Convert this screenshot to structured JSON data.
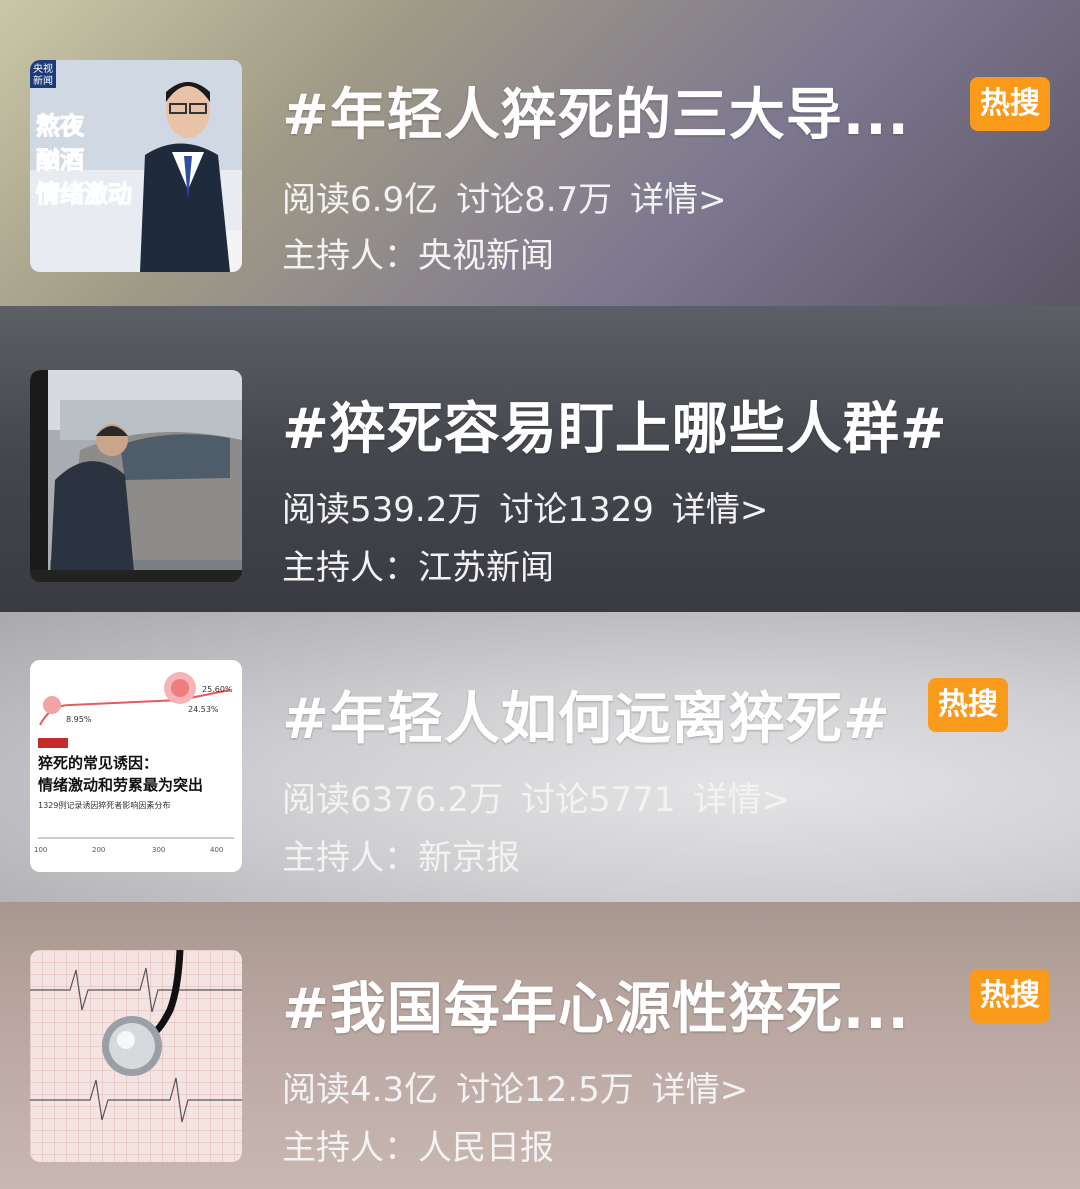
{
  "topics": [
    {
      "title": "#年轻人猝死的三大导...",
      "read": "阅读6.9亿",
      "discuss": "讨论8.7万",
      "detail": "详情>",
      "host": "主持人：央视新闻",
      "badge": "热搜",
      "thumb_logo": "央视新闻",
      "thumb_lines": [
        "熬夜",
        "酗酒",
        "情绪激动"
      ]
    },
    {
      "title": "#猝死容易盯上哪些人群#",
      "read": "阅读539.2万",
      "discuss": "讨论1329",
      "detail": "详情>",
      "host": "主持人：江苏新闻"
    },
    {
      "title": "#年轻人如何远离猝死#",
      "read": "阅读6376.2万",
      "discuss": "讨论5771",
      "detail": "详情>",
      "host": "主持人：新京报",
      "badge": "热搜",
      "thumb_heading1": "猝死的常见诱因：",
      "thumb_heading2": "情绪激动和劳累最为突出",
      "thumb_sub": "1329例记录诱因猝死者影响因素分布",
      "thumb_pct1": "25.60%",
      "thumb_pct2": "24.53%",
      "thumb_pct3": "8.95%",
      "thumb_ticks": [
        "100",
        "200",
        "300",
        "400"
      ]
    },
    {
      "title": "#我国每年心源性猝死...",
      "read": "阅读4.3亿",
      "discuss": "讨论12.5万",
      "detail": "详情>",
      "host": "主持人：人民日报",
      "badge": "热搜"
    }
  ],
  "colors": {
    "badge": "#f99a1b",
    "text": "#ffffff"
  }
}
